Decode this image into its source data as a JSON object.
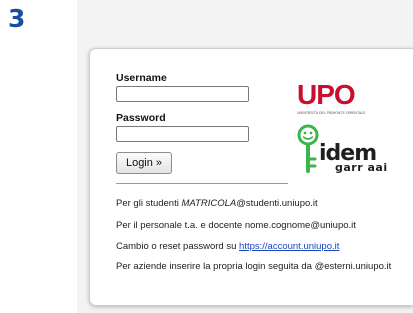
{
  "step": {
    "number": "3"
  },
  "form": {
    "username_label": "Username",
    "username_value": "",
    "password_label": "Password",
    "password_value": "",
    "login_button": "Login »"
  },
  "logos": {
    "upo_text": "UPO",
    "upo_caption": "UNIVERSITÀ DEL PIEMONTE ORIENTALE",
    "idem_text": "idem",
    "garr_text": "garr aai"
  },
  "info": {
    "line1_prefix": "Per gli studenti ",
    "line1_em": "MATRICOLA",
    "line1_suffix": "@studenti.uniupo.it",
    "line2": "Per il personale t.a. e docente nome.cognome@uniupo.it",
    "line3_prefix": "Cambio o reset password su ",
    "line3_link": "https://account.uniupo.it",
    "line4": "Per aziende inserire la propria login seguita da @esterni.uniupo.it"
  },
  "colors": {
    "step_number": "#1a4fa0",
    "upo_red": "#c8102e",
    "idem_green": "#3db54a",
    "link_blue": "#1a45c0"
  },
  "icons": {
    "idem_mascot": "smiley-key-icon"
  }
}
